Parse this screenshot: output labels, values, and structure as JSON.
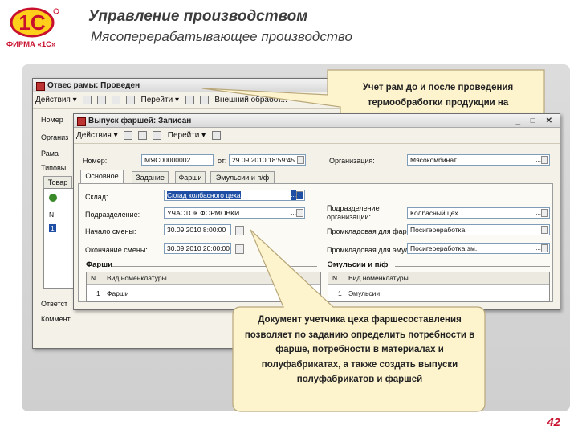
{
  "header": {
    "logo_text": "ФИРМА «1С»",
    "title": "Управление производством",
    "subtitle": "Мясоперерабатывающее производство"
  },
  "back_window": {
    "title": "Отвес рамы: Проведен",
    "toolbar": {
      "actions_label": "Действия",
      "goto_label": "Перейти",
      "extra_label": "Внешний обработ..."
    },
    "labels": [
      "Номер",
      "Организ",
      "Рама",
      "Типовы",
      "Ответст",
      "Коммент"
    ],
    "tab_label": "Товар",
    "col_n": "N",
    "row_n": "1"
  },
  "front_window": {
    "title": "Выпуск фаршей: Записан",
    "toolbar": {
      "actions_label": "Действия",
      "goto_label": "Перейти"
    },
    "fields": {
      "number_label": "Номер:",
      "number_value": "МЯС00000002",
      "date_label": "от:",
      "date_value": "29.09.2010 18:59:45",
      "org_label": "Организация:",
      "org_value": "Мясокомбинат",
      "warehouse_label": "Склад:",
      "warehouse_value": "Склад колбасного цеха",
      "division_label": "Подразделение:",
      "division_value": "УЧАСТОК ФОРМОВКИ",
      "org_division_label": "Подразделение организации:",
      "org_division_value": "Колбасный цех",
      "shift_start_label": "Начало смены:",
      "shift_start_value": "30.09.2010 8:00:00",
      "shift_end_label": "Окончание смены:",
      "shift_end_value": "30.09.2010 20:00:00",
      "stuffing_wh_label": "Промкладовая для фарша:",
      "stuffing_wh_value": "Посигереработка",
      "emulsion_wh_label": "Промкладовая для эмульсии:",
      "emulsion_wh_value": "Посигереработка эм."
    },
    "tabs": [
      "Основное",
      "Задание",
      "Фарши",
      "Эмульсии и п/ф"
    ],
    "left_section": {
      "title": "Фарши",
      "col_n": "N",
      "col_item": "Вид номенклатуры",
      "rows": [
        {
          "n": "1",
          "item": "Фарши"
        }
      ]
    },
    "right_section": {
      "title": "Эмульсии и п/ф",
      "col_n": "N",
      "col_item": "Вид номенклатуры",
      "rows": [
        {
          "n": "1",
          "item": "Эмульсии"
        }
      ]
    }
  },
  "callouts": {
    "top_text": "Учет рам до и после проведения термообработки продукции на",
    "bottom_text": "Документ учетчика цеха фаршесоставления позволяет по заданию определить потребности в фарше, потребности в материалах и полуфабрикатах, а также создать выпуски полуфабрикатов и фаршей"
  },
  "page_number": "42",
  "colors": {
    "brand_red": "#c8102e",
    "callout_fill": "#fdf4ce",
    "callout_border": "#b9a77a",
    "highlight_blue": "#1e4fa5"
  }
}
